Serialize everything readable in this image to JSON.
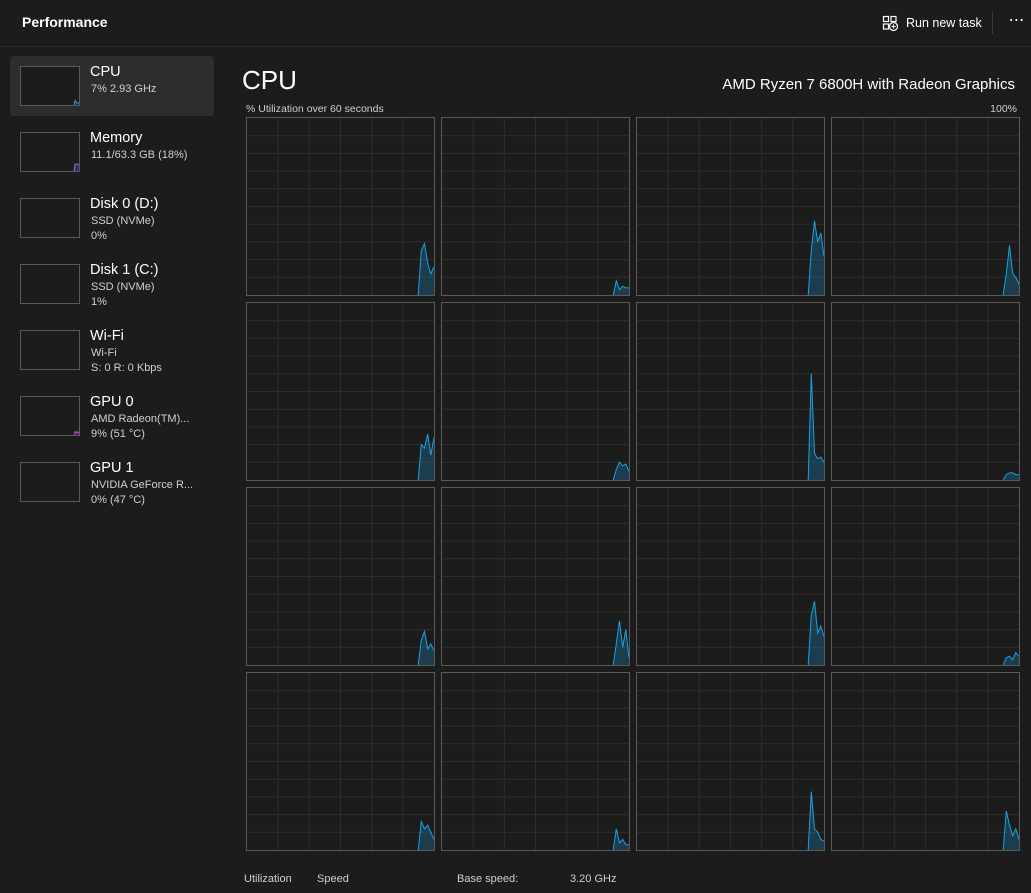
{
  "header": {
    "title": "Performance",
    "run_new_task_label": "Run new task",
    "more_label": "⋯"
  },
  "sidebar": {
    "items": [
      {
        "name": "CPU",
        "sub1": "7%  2.93 GHz",
        "sub2": "",
        "selected": true,
        "graph_color": "#1ba1e2",
        "sparkline": [
          0,
          0,
          0,
          0,
          0,
          0,
          0,
          0,
          0,
          0,
          0,
          0,
          0,
          0,
          0,
          0,
          0,
          0,
          0,
          0,
          0,
          0,
          0,
          0,
          0,
          0,
          0,
          0,
          0,
          0,
          0,
          0,
          0,
          0,
          0,
          0,
          0,
          0,
          0,
          0,
          0,
          0,
          0,
          0,
          0,
          0,
          0,
          0,
          0,
          0,
          0,
          0,
          0,
          0,
          0,
          12,
          7,
          5,
          6,
          6
        ]
      },
      {
        "name": "Memory",
        "sub1": "11.1/63.3 GB (18%)",
        "sub2": "",
        "selected": false,
        "graph_color": "#6d7cf2",
        "sparkline": [
          0,
          0,
          0,
          0,
          0,
          0,
          0,
          0,
          0,
          0,
          0,
          0,
          0,
          0,
          0,
          0,
          0,
          0,
          0,
          0,
          0,
          0,
          0,
          0,
          0,
          0,
          0,
          0,
          0,
          0,
          0,
          0,
          0,
          0,
          0,
          0,
          0,
          0,
          0,
          0,
          0,
          0,
          0,
          0,
          0,
          0,
          0,
          0,
          0,
          0,
          0,
          0,
          0,
          0,
          0,
          18,
          18,
          18,
          18,
          18
        ]
      },
      {
        "name": "Disk 0 (D:)",
        "sub1": "SSD (NVMe)",
        "sub2": "0%",
        "selected": false,
        "graph_color": "#4db86d",
        "sparkline": []
      },
      {
        "name": "Disk 1 (C:)",
        "sub1": "SSD (NVMe)",
        "sub2": "1%",
        "selected": false,
        "graph_color": "#4db86d",
        "sparkline": []
      },
      {
        "name": "Wi-Fi",
        "sub1": "Wi-Fi",
        "sub2": "S: 0 R: 0 Kbps",
        "selected": false,
        "graph_color": "#c17b2c",
        "sparkline": []
      },
      {
        "name": "GPU 0",
        "sub1": "AMD Radeon(TM)...",
        "sub2": "9%  (51 °C)",
        "selected": false,
        "graph_color": "#c13fc4",
        "sparkline": [
          0,
          0,
          0,
          0,
          0,
          0,
          0,
          0,
          0,
          0,
          0,
          0,
          0,
          0,
          0,
          0,
          0,
          0,
          0,
          0,
          0,
          0,
          0,
          0,
          0,
          0,
          0,
          0,
          0,
          0,
          0,
          0,
          0,
          0,
          0,
          0,
          0,
          0,
          0,
          0,
          0,
          0,
          0,
          0,
          0,
          0,
          0,
          0,
          0,
          0,
          0,
          0,
          0,
          0,
          0,
          9,
          6,
          9,
          5,
          9
        ]
      },
      {
        "name": "GPU 1",
        "sub1": "NVIDIA GeForce R...",
        "sub2": "0%  (47 °C)",
        "selected": false,
        "graph_color": "#c13fc4",
        "sparkline": []
      }
    ]
  },
  "main": {
    "title": "CPU",
    "model": "AMD Ryzen 7 6800H with Radeon Graphics",
    "util_label": "% Utilization over 60 seconds",
    "util_max": "100%",
    "line_color": "#1ba1e2",
    "cores": [
      {
        "history": [
          0,
          0,
          0,
          0,
          0,
          0,
          0,
          0,
          0,
          0,
          0,
          0,
          0,
          0,
          0,
          0,
          0,
          0,
          0,
          0,
          0,
          0,
          0,
          0,
          0,
          0,
          0,
          0,
          0,
          0,
          0,
          0,
          0,
          0,
          0,
          0,
          0,
          0,
          0,
          0,
          0,
          0,
          0,
          0,
          0,
          0,
          0,
          0,
          0,
          0,
          0,
          0,
          0,
          0,
          0,
          25,
          29,
          18,
          12,
          16
        ]
      },
      {
        "history": [
          0,
          0,
          0,
          0,
          0,
          0,
          0,
          0,
          0,
          0,
          0,
          0,
          0,
          0,
          0,
          0,
          0,
          0,
          0,
          0,
          0,
          0,
          0,
          0,
          0,
          0,
          0,
          0,
          0,
          0,
          0,
          0,
          0,
          0,
          0,
          0,
          0,
          0,
          0,
          0,
          0,
          0,
          0,
          0,
          0,
          0,
          0,
          0,
          0,
          0,
          0,
          0,
          0,
          0,
          0,
          8,
          3,
          5,
          4,
          4
        ]
      },
      {
        "history": [
          0,
          0,
          0,
          0,
          0,
          0,
          0,
          0,
          0,
          0,
          0,
          0,
          0,
          0,
          0,
          0,
          0,
          0,
          0,
          0,
          0,
          0,
          0,
          0,
          0,
          0,
          0,
          0,
          0,
          0,
          0,
          0,
          0,
          0,
          0,
          0,
          0,
          0,
          0,
          0,
          0,
          0,
          0,
          0,
          0,
          0,
          0,
          0,
          0,
          0,
          0,
          0,
          0,
          0,
          0,
          25,
          42,
          30,
          35,
          22
        ]
      },
      {
        "history": [
          0,
          0,
          0,
          0,
          0,
          0,
          0,
          0,
          0,
          0,
          0,
          0,
          0,
          0,
          0,
          0,
          0,
          0,
          0,
          0,
          0,
          0,
          0,
          0,
          0,
          0,
          0,
          0,
          0,
          0,
          0,
          0,
          0,
          0,
          0,
          0,
          0,
          0,
          0,
          0,
          0,
          0,
          0,
          0,
          0,
          0,
          0,
          0,
          0,
          0,
          0,
          0,
          0,
          0,
          0,
          12,
          28,
          12,
          10,
          6
        ]
      },
      {
        "history": [
          0,
          0,
          0,
          0,
          0,
          0,
          0,
          0,
          0,
          0,
          0,
          0,
          0,
          0,
          0,
          0,
          0,
          0,
          0,
          0,
          0,
          0,
          0,
          0,
          0,
          0,
          0,
          0,
          0,
          0,
          0,
          0,
          0,
          0,
          0,
          0,
          0,
          0,
          0,
          0,
          0,
          0,
          0,
          0,
          0,
          0,
          0,
          0,
          0,
          0,
          0,
          0,
          0,
          0,
          0,
          20,
          18,
          26,
          14,
          24
        ]
      },
      {
        "history": [
          0,
          0,
          0,
          0,
          0,
          0,
          0,
          0,
          0,
          0,
          0,
          0,
          0,
          0,
          0,
          0,
          0,
          0,
          0,
          0,
          0,
          0,
          0,
          0,
          0,
          0,
          0,
          0,
          0,
          0,
          0,
          0,
          0,
          0,
          0,
          0,
          0,
          0,
          0,
          0,
          0,
          0,
          0,
          0,
          0,
          0,
          0,
          0,
          0,
          0,
          0,
          0,
          0,
          0,
          0,
          6,
          10,
          8,
          9,
          5
        ]
      },
      {
        "history": [
          0,
          0,
          0,
          0,
          0,
          0,
          0,
          0,
          0,
          0,
          0,
          0,
          0,
          0,
          0,
          0,
          0,
          0,
          0,
          0,
          0,
          0,
          0,
          0,
          0,
          0,
          0,
          0,
          0,
          0,
          0,
          0,
          0,
          0,
          0,
          0,
          0,
          0,
          0,
          0,
          0,
          0,
          0,
          0,
          0,
          0,
          0,
          0,
          0,
          0,
          0,
          0,
          0,
          0,
          0,
          60,
          15,
          12,
          13,
          10
        ]
      },
      {
        "history": [
          0,
          0,
          0,
          0,
          0,
          0,
          0,
          0,
          0,
          0,
          0,
          0,
          0,
          0,
          0,
          0,
          0,
          0,
          0,
          0,
          0,
          0,
          0,
          0,
          0,
          0,
          0,
          0,
          0,
          0,
          0,
          0,
          0,
          0,
          0,
          0,
          0,
          0,
          0,
          0,
          0,
          0,
          0,
          0,
          0,
          0,
          0,
          0,
          0,
          0,
          0,
          0,
          0,
          0,
          0,
          3,
          4,
          4,
          3,
          3
        ]
      },
      {
        "history": [
          0,
          0,
          0,
          0,
          0,
          0,
          0,
          0,
          0,
          0,
          0,
          0,
          0,
          0,
          0,
          0,
          0,
          0,
          0,
          0,
          0,
          0,
          0,
          0,
          0,
          0,
          0,
          0,
          0,
          0,
          0,
          0,
          0,
          0,
          0,
          0,
          0,
          0,
          0,
          0,
          0,
          0,
          0,
          0,
          0,
          0,
          0,
          0,
          0,
          0,
          0,
          0,
          0,
          0,
          0,
          14,
          19,
          9,
          12,
          8
        ]
      },
      {
        "history": [
          0,
          0,
          0,
          0,
          0,
          0,
          0,
          0,
          0,
          0,
          0,
          0,
          0,
          0,
          0,
          0,
          0,
          0,
          0,
          0,
          0,
          0,
          0,
          0,
          0,
          0,
          0,
          0,
          0,
          0,
          0,
          0,
          0,
          0,
          0,
          0,
          0,
          0,
          0,
          0,
          0,
          0,
          0,
          0,
          0,
          0,
          0,
          0,
          0,
          0,
          0,
          0,
          0,
          0,
          0,
          12,
          25,
          10,
          20,
          4
        ]
      },
      {
        "history": [
          0,
          0,
          0,
          0,
          0,
          0,
          0,
          0,
          0,
          0,
          0,
          0,
          0,
          0,
          0,
          0,
          0,
          0,
          0,
          0,
          0,
          0,
          0,
          0,
          0,
          0,
          0,
          0,
          0,
          0,
          0,
          0,
          0,
          0,
          0,
          0,
          0,
          0,
          0,
          0,
          0,
          0,
          0,
          0,
          0,
          0,
          0,
          0,
          0,
          0,
          0,
          0,
          0,
          0,
          0,
          28,
          36,
          18,
          22,
          16
        ]
      },
      {
        "history": [
          0,
          0,
          0,
          0,
          0,
          0,
          0,
          0,
          0,
          0,
          0,
          0,
          0,
          0,
          0,
          0,
          0,
          0,
          0,
          0,
          0,
          0,
          0,
          0,
          0,
          0,
          0,
          0,
          0,
          0,
          0,
          0,
          0,
          0,
          0,
          0,
          0,
          0,
          0,
          0,
          0,
          0,
          0,
          0,
          0,
          0,
          0,
          0,
          0,
          0,
          0,
          0,
          0,
          0,
          0,
          4,
          5,
          3,
          7,
          5
        ]
      },
      {
        "history": [
          0,
          0,
          0,
          0,
          0,
          0,
          0,
          0,
          0,
          0,
          0,
          0,
          0,
          0,
          0,
          0,
          0,
          0,
          0,
          0,
          0,
          0,
          0,
          0,
          0,
          0,
          0,
          0,
          0,
          0,
          0,
          0,
          0,
          0,
          0,
          0,
          0,
          0,
          0,
          0,
          0,
          0,
          0,
          0,
          0,
          0,
          0,
          0,
          0,
          0,
          0,
          0,
          0,
          0,
          0,
          16,
          12,
          14,
          10,
          6
        ]
      },
      {
        "history": [
          0,
          0,
          0,
          0,
          0,
          0,
          0,
          0,
          0,
          0,
          0,
          0,
          0,
          0,
          0,
          0,
          0,
          0,
          0,
          0,
          0,
          0,
          0,
          0,
          0,
          0,
          0,
          0,
          0,
          0,
          0,
          0,
          0,
          0,
          0,
          0,
          0,
          0,
          0,
          0,
          0,
          0,
          0,
          0,
          0,
          0,
          0,
          0,
          0,
          0,
          0,
          0,
          0,
          0,
          0,
          12,
          4,
          6,
          3,
          3
        ]
      },
      {
        "history": [
          0,
          0,
          0,
          0,
          0,
          0,
          0,
          0,
          0,
          0,
          0,
          0,
          0,
          0,
          0,
          0,
          0,
          0,
          0,
          0,
          0,
          0,
          0,
          0,
          0,
          0,
          0,
          0,
          0,
          0,
          0,
          0,
          0,
          0,
          0,
          0,
          0,
          0,
          0,
          0,
          0,
          0,
          0,
          0,
          0,
          0,
          0,
          0,
          0,
          0,
          0,
          0,
          0,
          0,
          0,
          33,
          12,
          10,
          6,
          5
        ]
      },
      {
        "history": [
          0,
          0,
          0,
          0,
          0,
          0,
          0,
          0,
          0,
          0,
          0,
          0,
          0,
          0,
          0,
          0,
          0,
          0,
          0,
          0,
          0,
          0,
          0,
          0,
          0,
          0,
          0,
          0,
          0,
          0,
          0,
          0,
          0,
          0,
          0,
          0,
          0,
          0,
          0,
          0,
          0,
          0,
          0,
          0,
          0,
          0,
          0,
          0,
          0,
          0,
          0,
          0,
          0,
          0,
          0,
          22,
          14,
          8,
          12,
          6
        ]
      }
    ],
    "stats": {
      "utilization_label": "Utilization",
      "speed_label": "Speed",
      "base_speed_label": "Base speed:",
      "base_speed_value": "3.20 GHz"
    }
  }
}
